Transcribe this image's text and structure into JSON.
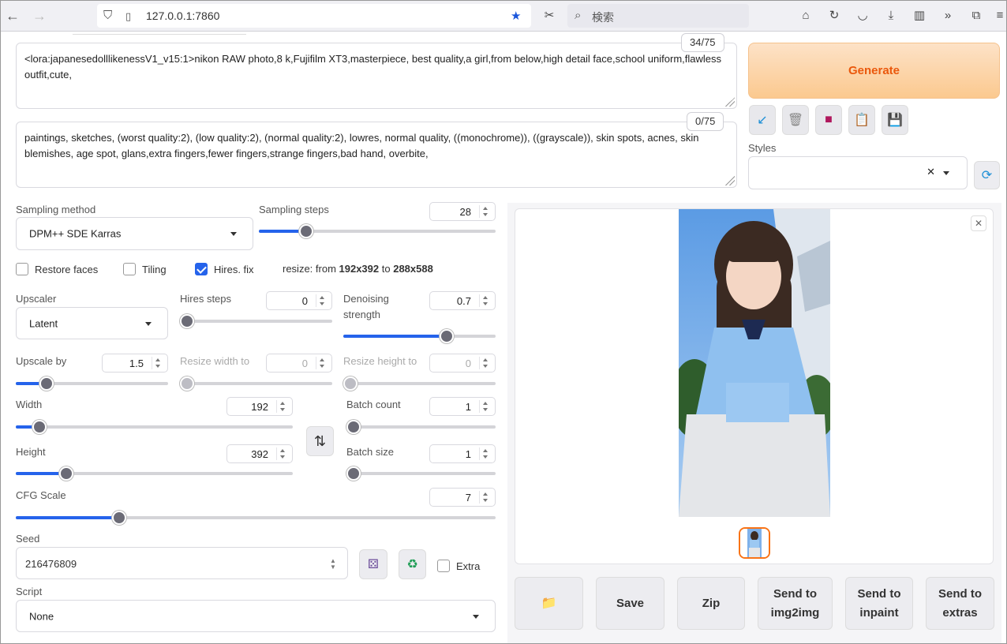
{
  "browser": {
    "url": "127.0.0.1:7860",
    "search_placeholder": "検索"
  },
  "prompt": {
    "positive": "<lora:japanesedolllikenessV1_v15:1>nikon RAW photo,8 k,Fujifilm XT3,masterpiece, best quality,a girl,from below,high detail face,school uniform,flawless outfit,cute,",
    "positive_counter": "34/75",
    "negative": "paintings, sketches, (worst quality:2), (low quality:2), (normal quality:2), lowres, normal quality, ((monochrome)), ((grayscale)), skin spots, acnes, skin blemishes, age spot, glans,extra fingers,fewer fingers,strange fingers,bad hand, overbite,",
    "negative_counter": "0/75"
  },
  "generate": {
    "label": "Generate"
  },
  "styles": {
    "label": "Styles",
    "value": ""
  },
  "sampling": {
    "method_label": "Sampling method",
    "method_value": "DPM++ SDE Karras",
    "steps_label": "Sampling steps",
    "steps_value": "28",
    "steps_fraction": 0.19
  },
  "checks": {
    "restore_faces": {
      "label": "Restore faces",
      "checked": false
    },
    "tiling": {
      "label": "Tiling",
      "checked": false
    },
    "hires_fix": {
      "label": "Hires. fix",
      "checked": true
    },
    "resize_prefix": "resize: from ",
    "resize_from": "192x392",
    "resize_mid": " to ",
    "resize_to": "288x588"
  },
  "hires": {
    "upscaler_label": "Upscaler",
    "upscaler_value": "Latent",
    "steps_label": "Hires steps",
    "steps_value": "0",
    "denoise_label_1": "Denoising",
    "denoise_label_2": "strength",
    "denoise_value": "0.7",
    "upscale_by_label": "Upscale by",
    "upscale_by_value": "1.5",
    "resize_w_label": "Resize width to",
    "resize_w_value": "0",
    "resize_h_label": "Resize height to",
    "resize_h_value": "0"
  },
  "size": {
    "width_label": "Width",
    "width_value": "192",
    "height_label": "Height",
    "height_value": "392",
    "batch_count_label": "Batch count",
    "batch_count_value": "1",
    "batch_size_label": "Batch size",
    "batch_size_value": "1"
  },
  "cfg": {
    "label": "CFG Scale",
    "value": "7"
  },
  "seed": {
    "label": "Seed",
    "value": "216476809",
    "extra_label": "Extra"
  },
  "script": {
    "label": "Script",
    "value": "None"
  },
  "actions": {
    "folder": "folder-icon",
    "save": "Save",
    "zip": "Zip",
    "img2img_1": "Send to",
    "img2img_2": "img2img",
    "inpaint_1": "Send to",
    "inpaint_2": "inpaint",
    "extras_1": "Send to",
    "extras_2": "extras"
  },
  "colors": {
    "accent": "#2563eb",
    "generate": "#ea580c",
    "selected_thumb": "#f97316"
  }
}
